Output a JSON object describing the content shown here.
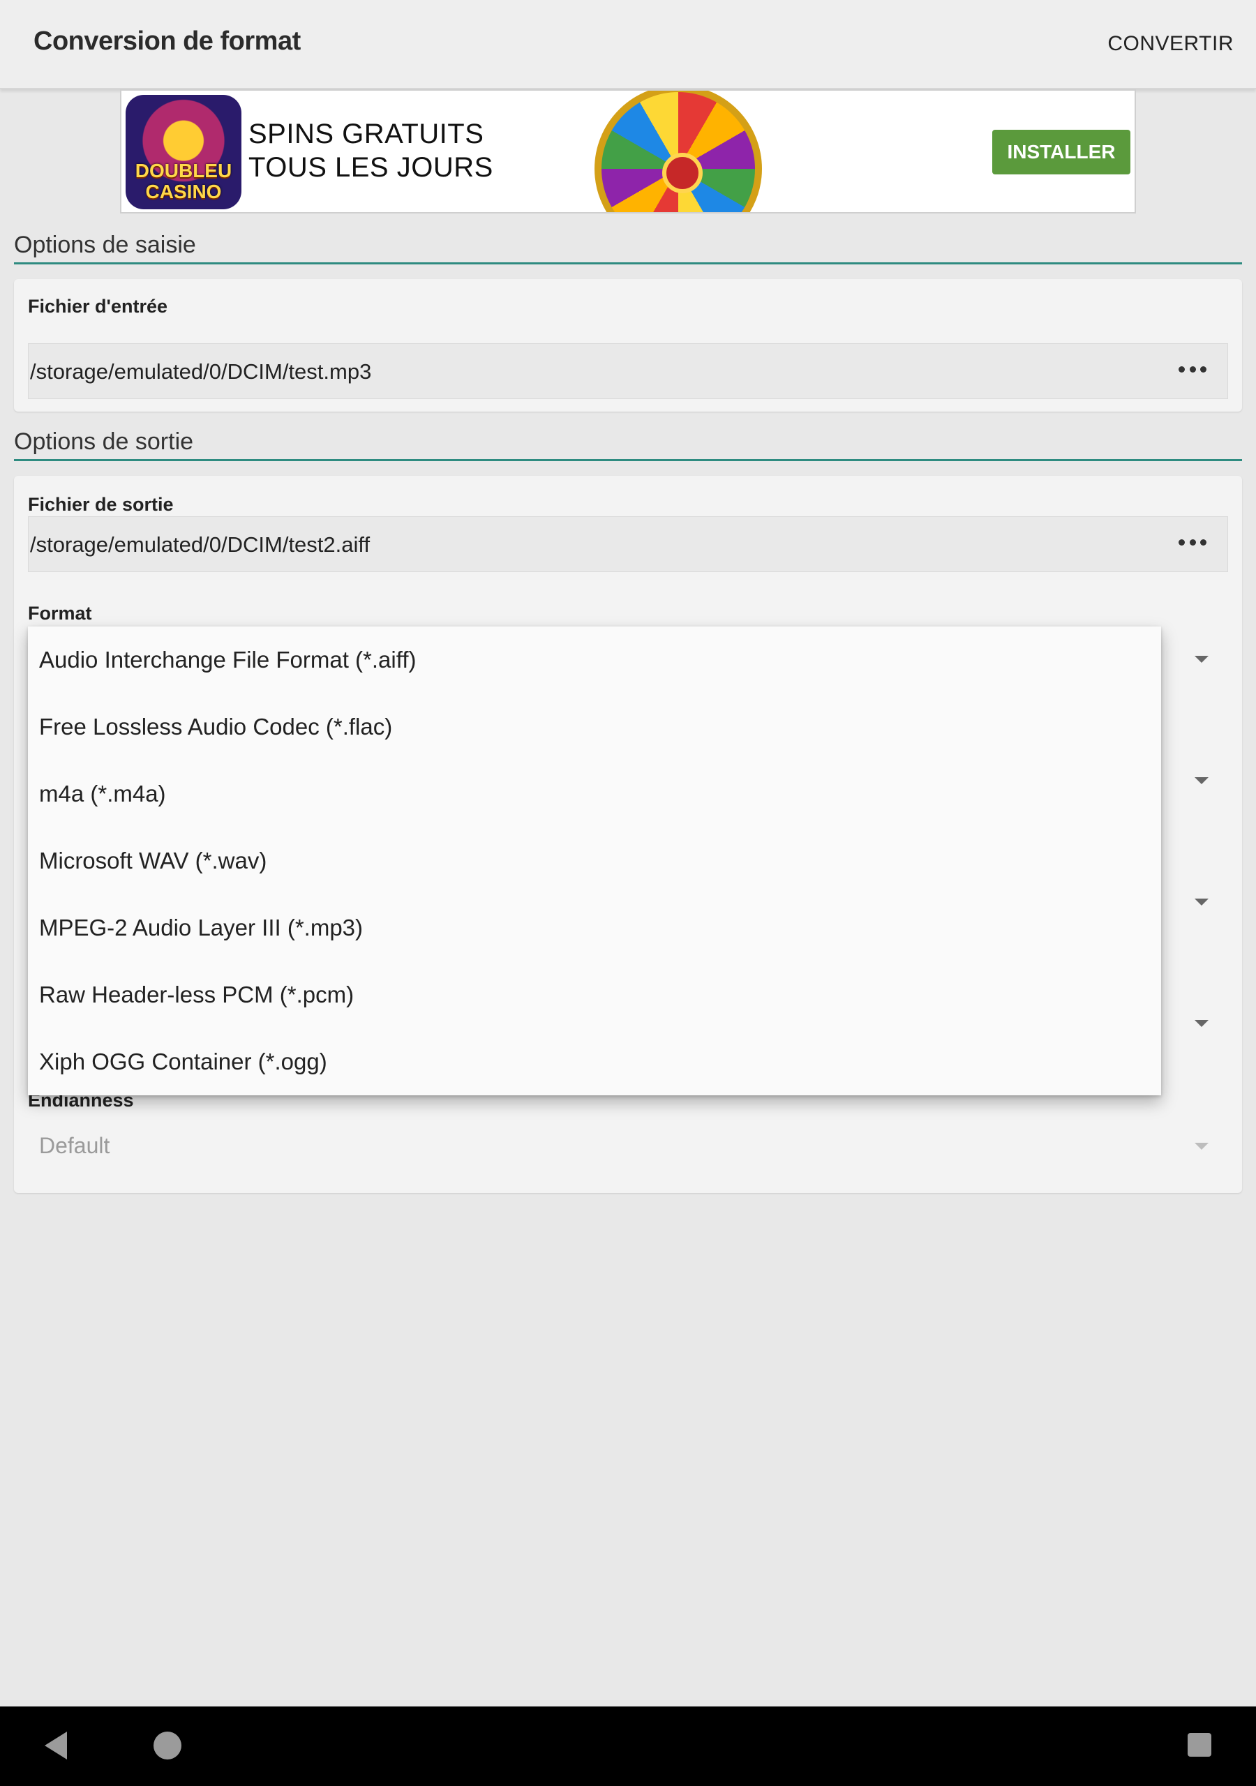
{
  "appbar": {
    "title": "Conversion de format",
    "action_label": "CONVERTIR"
  },
  "ad": {
    "logo_text": "DOUBLEU CASINO",
    "headline_line1": "SPINS GRATUITS",
    "headline_line2": "TOUS LES JOURS",
    "install_label": "INSTALLER",
    "install_color": "#5b9a3c"
  },
  "input_section": {
    "title": "Options de saisie",
    "input_file_label": "Fichier d'entrée",
    "input_file_value": "/storage/emulated/0/DCIM/test.mp3"
  },
  "output_section": {
    "title": "Options de sortie",
    "output_file_label": "Fichier de sortie",
    "output_file_value": "/storage/emulated/0/DCIM/test2.aiff",
    "format_label": "Format",
    "endianness_label": "Endianness",
    "endianness_value": "Default"
  },
  "format_dropdown": {
    "options": [
      "Audio Interchange File Format (*.aiff)",
      "Free Lossless Audio Codec (*.flac)",
      "m4a (*.m4a)",
      "Microsoft WAV (*.wav)",
      "MPEG-2 Audio Layer III (*.mp3)",
      "Raw Header-less PCM (*.pcm)",
      "Xiph OGG Container (*.ogg)"
    ]
  },
  "colors": {
    "accent_line": "#2e8b80",
    "background": "#e8e8e8"
  }
}
